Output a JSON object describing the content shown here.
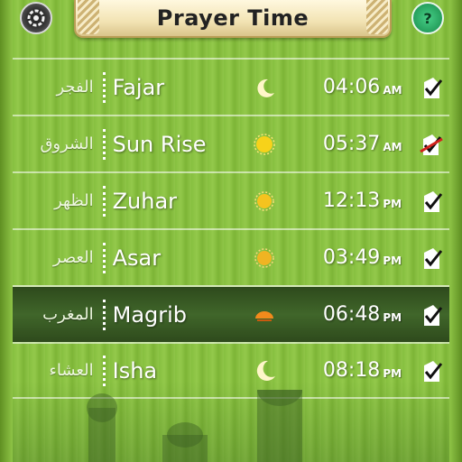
{
  "header": {
    "title": "Prayer Time",
    "left_icon": "compass-icon",
    "right_icon": "help-icon",
    "right_glyph": "?"
  },
  "prayers": [
    {
      "arabic": "الفجر",
      "name": "Fajar",
      "icon": "crescent-moon-icon",
      "time": "04:06",
      "ampm": "AM",
      "alarm": "checked"
    },
    {
      "arabic": "الشروق",
      "name": "Sun Rise",
      "icon": "sun-icon",
      "time": "05:37",
      "ampm": "AM",
      "alarm": "off"
    },
    {
      "arabic": "الظهر",
      "name": "Zuhar",
      "icon": "sun-small-icon",
      "time": "12:13",
      "ampm": "PM",
      "alarm": "checked"
    },
    {
      "arabic": "العصر",
      "name": "Asar",
      "icon": "sun-small-icon",
      "time": "03:49",
      "ampm": "PM",
      "alarm": "checked"
    },
    {
      "arabic": "المغرب",
      "name": "Magrib",
      "icon": "sunset-icon",
      "time": "06:48",
      "ampm": "PM",
      "alarm": "checked",
      "highlighted": true
    },
    {
      "arabic": "العشاء",
      "name": "Isha",
      "icon": "crescent-moon-icon",
      "time": "08:18",
      "ampm": "PM",
      "alarm": "checked"
    }
  ],
  "colors": {
    "background": "#8cc045",
    "highlight_row": "#3a5e24",
    "sun": "#f7d21a",
    "moon": "#fff6c9"
  }
}
